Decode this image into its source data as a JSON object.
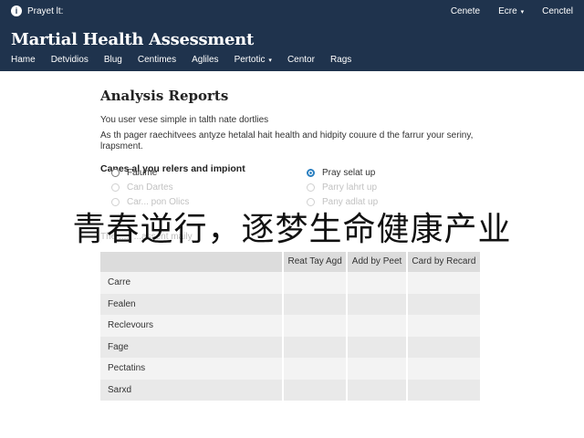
{
  "header": {
    "brand_icon": "info-icon",
    "brand_label": "Prayet lt:",
    "top_links": [
      "Cenete",
      "Ecre",
      "Cenctel"
    ],
    "site_title": "Martial Health Assessment",
    "nav": [
      "Hame",
      "Detvidios",
      "Blug",
      "Centimes",
      "Agliles",
      "Pertotic",
      "Centor",
      "Rags"
    ],
    "bg_color": "#1f334d"
  },
  "main": {
    "page_title": "Analysis Reports",
    "intro": "You user vese simple in talth nate dortlies",
    "desc": "As th pager raechitvees antyze hetalal hait health and hidpity couure d the farrur your seriny, lrapsment.",
    "options_heading": "Canes al you relers and impiont",
    "options": [
      {
        "label": "Falume",
        "checked": false
      },
      {
        "label": "Pray selat up",
        "checked": true
      },
      {
        "label": "Can Dartes",
        "checked": false
      },
      {
        "label": "Parry lahrt up",
        "checked": false
      },
      {
        "label": "Car... pon Olics",
        "checked": false
      },
      {
        "label": "Pany adlat up",
        "checked": false
      }
    ],
    "faded_table_title": "The ..... ...assent maily",
    "accent_color": "#2a7fc0"
  },
  "table": {
    "headers": [
      "",
      "Reat Tay Agd",
      "Add by Peet",
      "Card by Recard"
    ],
    "rows": [
      "Carre",
      "Fealen",
      "Reclevours",
      "Fage",
      "Pectatins",
      "Sarxd"
    ]
  },
  "overlay": {
    "text": "青春逆行，逐梦生命健康产业"
  }
}
